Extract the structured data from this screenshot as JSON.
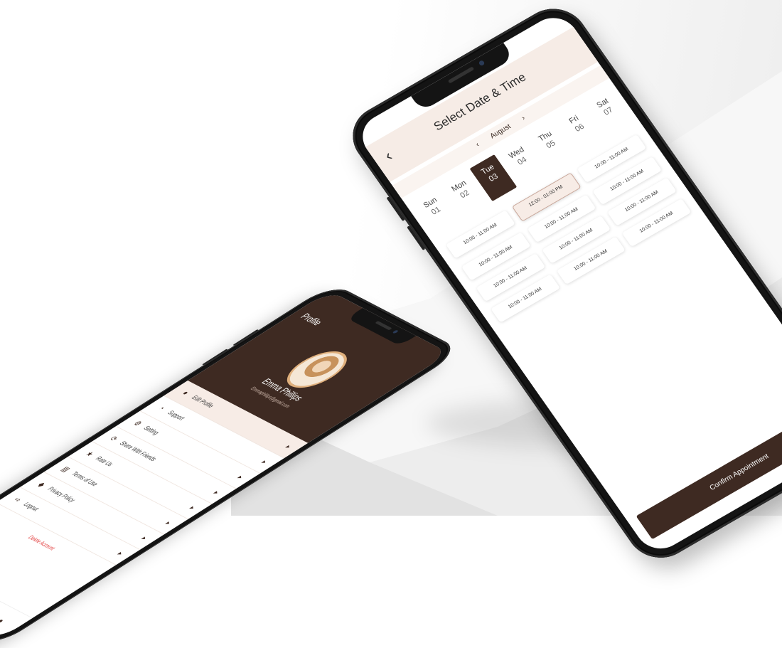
{
  "booking": {
    "title": "Select Date & Time",
    "back_icon": "chevron-left-icon",
    "month": "August",
    "prev_icon": "chevron-left-icon",
    "next_icon": "chevron-right-icon",
    "days": [
      {
        "name": "Sun",
        "date": "01"
      },
      {
        "name": "Mon",
        "date": "02"
      },
      {
        "name": "Tue",
        "date": "03",
        "selected": true
      },
      {
        "name": "Wed",
        "date": "04"
      },
      {
        "name": "Thu",
        "date": "05"
      },
      {
        "name": "Fri",
        "date": "06"
      },
      {
        "name": "Sat",
        "date": "07"
      }
    ],
    "slots": [
      "10:00 - 11:00 AM",
      "12:00 - 01:00 PM",
      "10:00 - 11:00 AM",
      "10:00 - 11:00 AM",
      "10:00 - 11:00 AM",
      "10:00 - 11:00 AM",
      "10:00 - 11:00 AM",
      "10:00 - 11:00 AM",
      "10:00 - 11:00 AM",
      "10:00 - 11:00 AM",
      "10:00 - 11:00 AM",
      "10:00 - 11:00 AM"
    ],
    "selected_slot_index": 1,
    "confirm_label": "Confirm Appointment",
    "accent_color": "#3e2a22"
  },
  "profile": {
    "title": "Profile",
    "name": "Emma Phillips",
    "email": "Emmaphillips@gmail.com",
    "menu": [
      {
        "label": "Edit Profile",
        "icon": "user-icon"
      },
      {
        "label": "Support",
        "icon": "headset-icon"
      },
      {
        "label": "Setting",
        "icon": "gear-icon"
      },
      {
        "label": "Share With Friends",
        "icon": "share-icon"
      },
      {
        "label": "Rate Us",
        "icon": "star-icon"
      },
      {
        "label": "Terms of Use",
        "icon": "document-icon"
      },
      {
        "label": "Privacy Policy",
        "icon": "shield-icon"
      },
      {
        "label": "Logout",
        "icon": "logout-icon"
      }
    ],
    "delete_label": "Delete Account",
    "nav": [
      "home-icon",
      "bell-icon",
      "calendar-icon",
      "user-icon"
    ],
    "delete_color": "#e23b3b"
  }
}
